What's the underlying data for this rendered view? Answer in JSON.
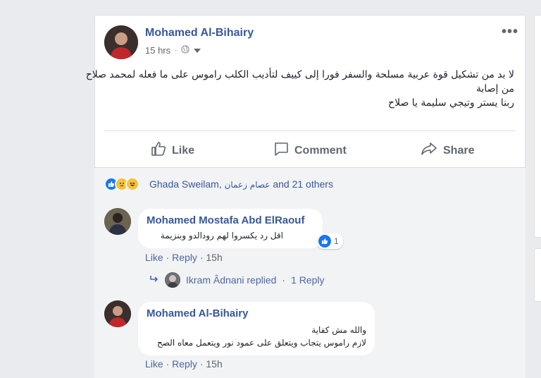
{
  "post": {
    "author": "Mohamed Al-Bihairy",
    "time": "15 hrs",
    "separator": "·",
    "more": "•••",
    "text_lines": [
      "لا بد من تشكيل قوة عربية مسلحة والسفر فورا إلى كييف لتأديب الكلب راموس على ما فعله لمحمد صلاح",
      "من إصابة",
      "ربنا يستر وتيجي سليمة يا صلاح"
    ]
  },
  "actions": {
    "like": "Like",
    "comment": "Comment",
    "share": "Share"
  },
  "reactions": {
    "name1": "Ghada Sweilam,",
    "name2": "عصام زعمان",
    "rest": "and 21 others"
  },
  "comments": [
    {
      "author": "Mohamed Mostafa Abd ElRaouf",
      "text": "اقل رد يكسروا لهم رودالدو وبنزيمة",
      "like_count": "1",
      "like": "Like",
      "reply": "Reply",
      "time": "15h"
    },
    {
      "author": "Mohamed Al-Bihairy",
      "text_lines": [
        "والله مش كفاية",
        "لازم راموس يتجاب ويتعلق على عمود نور ويتعمل معاه الصح"
      ],
      "like": "Like",
      "reply": "Reply",
      "time": "15h"
    }
  ],
  "reply_summary": {
    "name": "Ikram Âdnani replied",
    "dot": "·",
    "count": "1 Reply"
  },
  "colors": {
    "link": "#365899",
    "like_blue": "#1877f2"
  }
}
